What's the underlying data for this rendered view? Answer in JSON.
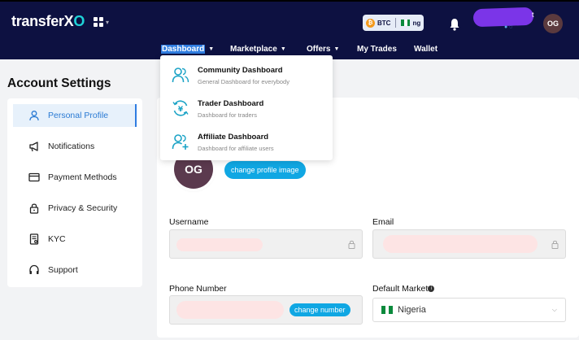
{
  "header": {
    "logo_text": "transferX",
    "logo_suffix": "O",
    "pair": {
      "base": "BTC",
      "quote": "ng"
    },
    "avatar_initials": "OG"
  },
  "nav": {
    "items": [
      {
        "label": "Dashboard",
        "has_caret": true,
        "active": true
      },
      {
        "label": "Marketplace",
        "has_caret": true
      },
      {
        "label": "Offers",
        "has_caret": true
      },
      {
        "label": "My Trades",
        "has_caret": false
      },
      {
        "label": "Wallet",
        "has_caret": false
      }
    ]
  },
  "dropdown": {
    "items": [
      {
        "title": "Community Dashboard",
        "subtitle": "General Dashboard for everybody",
        "icon": "users-icon"
      },
      {
        "title": "Trader Dashboard",
        "subtitle": "Dashboard for traders",
        "icon": "yen-cycle-icon"
      },
      {
        "title": "Affiliate Dashboard",
        "subtitle": "Dashboard for affiliate users",
        "icon": "user-plus-icon"
      }
    ]
  },
  "sidebar": {
    "title": "Account Settings",
    "items": [
      {
        "label": "Personal Profile",
        "icon": "user-icon",
        "active": true
      },
      {
        "label": "Notifications",
        "icon": "megaphone-icon"
      },
      {
        "label": "Payment Methods",
        "icon": "credit-card-icon"
      },
      {
        "label": "Privacy & Security",
        "icon": "lock-icon"
      },
      {
        "label": "KYC",
        "icon": "id-document-icon"
      },
      {
        "label": "Support",
        "icon": "headset-icon"
      }
    ]
  },
  "profile": {
    "avatar_initials": "OG",
    "change_image_label": "change profile image",
    "username_label": "Username",
    "email_label": "Email",
    "phone_label": "Phone Number",
    "change_number_label": "change number",
    "market_label": "Default Market",
    "market_value": "Nigeria"
  },
  "colors": {
    "header_bg": "#0d1141",
    "accent": "#10a7e3",
    "active_nav": "#2f7de1",
    "icon_teal": "#1ba3c6"
  }
}
